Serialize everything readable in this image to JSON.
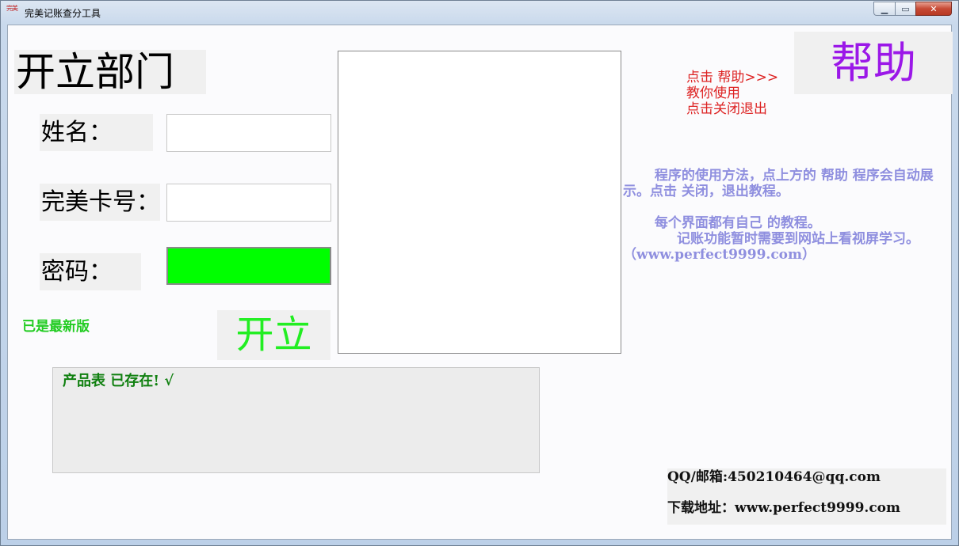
{
  "window": {
    "title": "完美记账查分工具",
    "icon_text": "完美",
    "controls": {
      "minimize": "▁",
      "maximize": "▭",
      "close": "✕"
    }
  },
  "form": {
    "heading": "开立部门",
    "name_label": "姓名：",
    "name_value": "",
    "card_label": "完美卡号：",
    "card_value": "",
    "password_label": "密码：",
    "password_value": "",
    "password_field_color": "#00ff00",
    "submit_label": "开立",
    "version_status": "已是最新版"
  },
  "log": {
    "text": "产品表 已存在!   √"
  },
  "help": {
    "hint_line1": "点击  帮助>>>",
    "hint_line2": "教你使用",
    "hint_line3": "点击关闭退出",
    "button_label": "帮助",
    "button_color": "#9b18e8"
  },
  "instructions": {
    "paragraph1": "　　 程序的使用方法，点上方的  帮助 程序会自动展示。点击  关闭，退出教程。",
    "paragraph2": "　　 每个界面都有自己 的教程。",
    "paragraph3": "　　　　记账功能暂时需要到网站上看视屏学习。（www.perfect9999.com）"
  },
  "contact": {
    "qq_email": "QQ/邮箱:450210464@qq.com",
    "download": "下载地址：www.perfect9999.com"
  }
}
